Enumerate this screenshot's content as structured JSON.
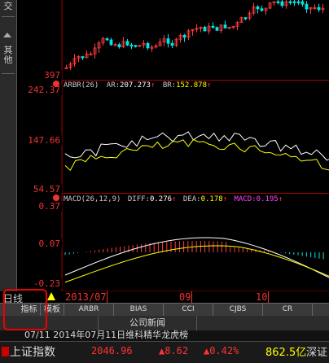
{
  "sidebar": {
    "tab_top": "交",
    "tab_other": "其他"
  },
  "price_axis": {
    "low_label": "397"
  },
  "arbr": {
    "name": "ARBR(26)",
    "ar_label": "AR:",
    "ar_value": "207.273",
    "br_label": "BR:",
    "br_value": "152.878",
    "up_arrow": "↑",
    "axis_top": "242.37",
    "axis_mid": "147.66",
    "axis_low": "54.57"
  },
  "macd": {
    "name": "MACD(26,12,9)",
    "diff_label": "DIFF:",
    "diff_value": "0.276",
    "dea_label": "DEA:",
    "dea_value": "0.178",
    "macd_label": "MACD:",
    "macd_value": "0.195",
    "up_arrow": "↑",
    "axis_top": "0.37",
    "axis_mid": "0.07",
    "axis_low": "-0.23"
  },
  "datebar": {
    "period": "日线",
    "date_start": "2013/07",
    "month_1": "09",
    "month_2": "10"
  },
  "tabs": {
    "indicator": "指标",
    "template": "模板",
    "items": [
      "ARBR",
      "BIAS",
      "CCI",
      "CJBS",
      "CR"
    ]
  },
  "news": {
    "company_news": "公司新闻"
  },
  "ticker": {
    "headline": "07/11 2014年07月11日维科精华龙虎榜"
  },
  "index_bar": {
    "name": "上证指数",
    "value": "2046.96",
    "change": "▲8.62",
    "change_pct": "▲0.42%",
    "turnover": "862.5亿",
    "next": "深证"
  },
  "colors": {
    "up": "#ff3b3b",
    "down": "#00e5e5",
    "white_line": "#ffffff",
    "yellow_line": "#ffff00",
    "magenta": "#ff40ff",
    "axis_red": "#e33"
  }
}
